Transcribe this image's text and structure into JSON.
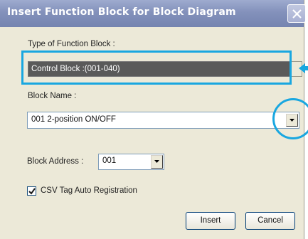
{
  "dialog": {
    "title": "Insert Function Block for Block Diagram",
    "close_icon": "close-icon"
  },
  "type_of_function_block": {
    "label": "Type of Function Block :",
    "value": "Control Block :(001-040)"
  },
  "block_name": {
    "label": "Block Name :",
    "value": "001  2-position ON/OFF"
  },
  "block_address": {
    "label": "Block Address :",
    "value": "001"
  },
  "csv_tag": {
    "label": "CSV Tag Auto Registration",
    "checked": true
  },
  "buttons": {
    "insert_label": "Insert",
    "cancel_label": "Cancel"
  },
  "colors": {
    "annotation": "#19a7e0",
    "titlebar": "#8391bb",
    "dialog_bg": "#ece9d8"
  }
}
